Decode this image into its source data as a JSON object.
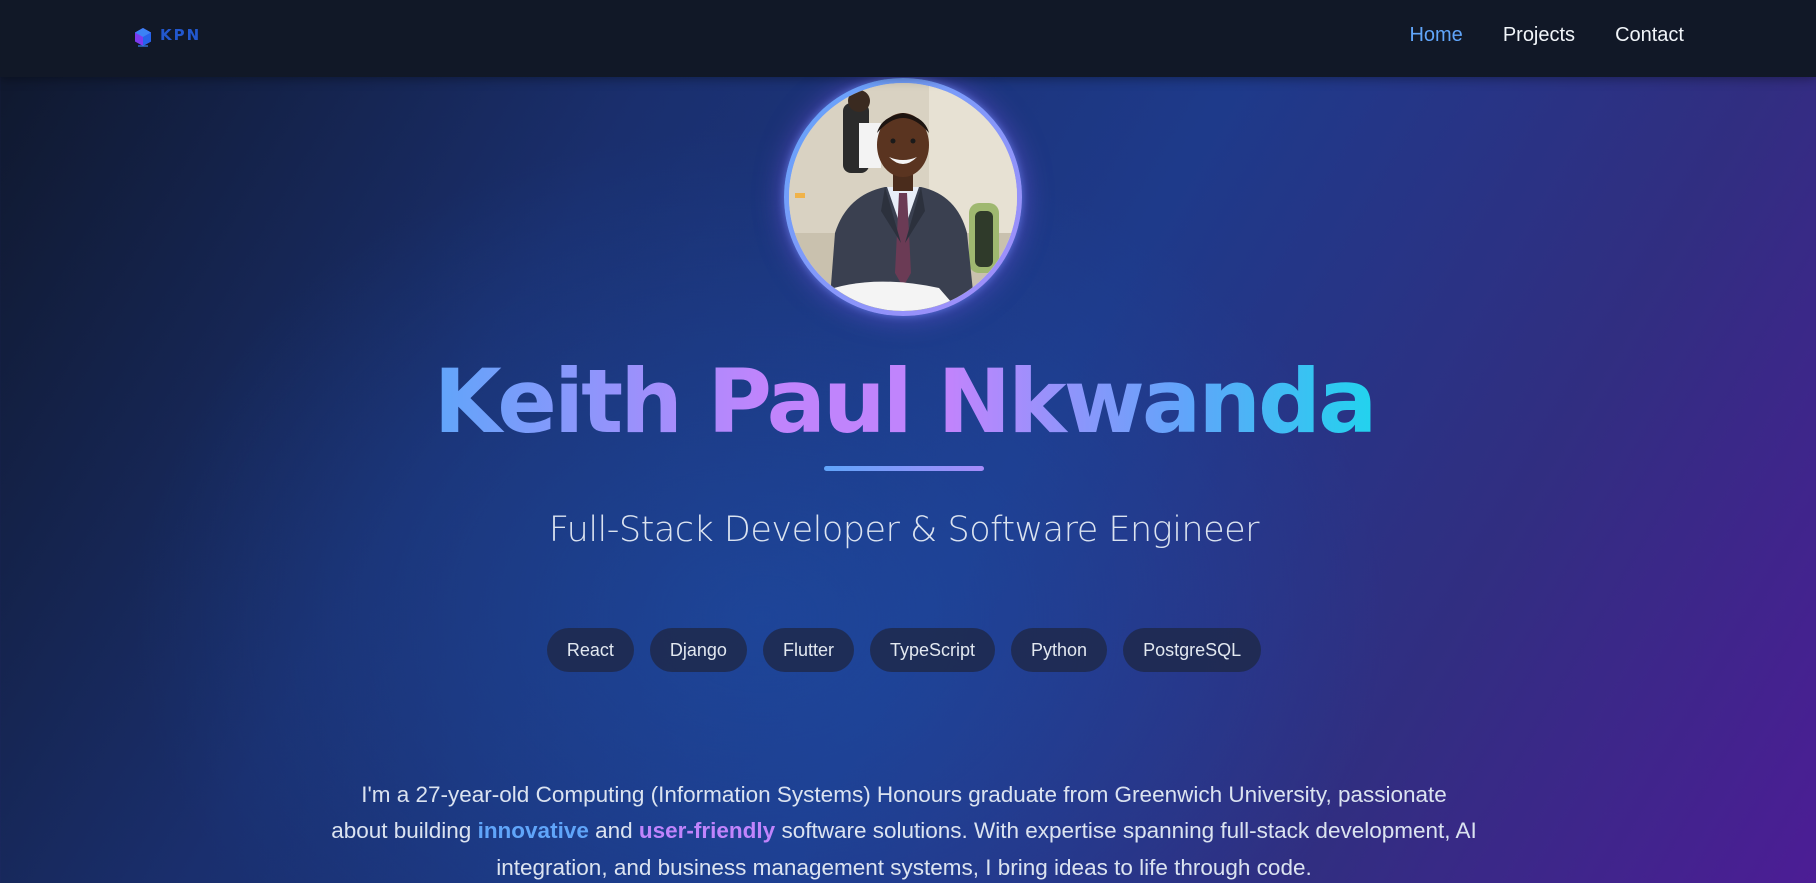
{
  "nav": {
    "logo_text": "KPN",
    "links": [
      {
        "label": "Home",
        "active": true
      },
      {
        "label": "Projects",
        "active": false
      },
      {
        "label": "Contact",
        "active": false
      }
    ]
  },
  "hero": {
    "name": "Keith Paul Nkwanda",
    "subtitle": "Full-Stack Developer & Software Engineer",
    "tags": [
      "React",
      "Django",
      "Flutter",
      "TypeScript",
      "Python",
      "PostgreSQL"
    ],
    "bio": {
      "part1": "I'm a 27-year-old Computing (Information Systems) Honours graduate from Greenwich University, passionate about building ",
      "highlight1": "innovative",
      "part2": " and ",
      "highlight2": "user-friendly",
      "part3": " software solutions. With expertise spanning full-stack development, AI integration, and business management systems, I bring ideas to life through code."
    }
  },
  "colors": {
    "nav_bg": "#111827",
    "accent_blue": "#60a5fa",
    "accent_purple": "#c084fc",
    "accent_cyan": "#22d3ee"
  },
  "icons": {
    "logo": "hexagon-logo-icon",
    "avatar": "profile-photo"
  }
}
